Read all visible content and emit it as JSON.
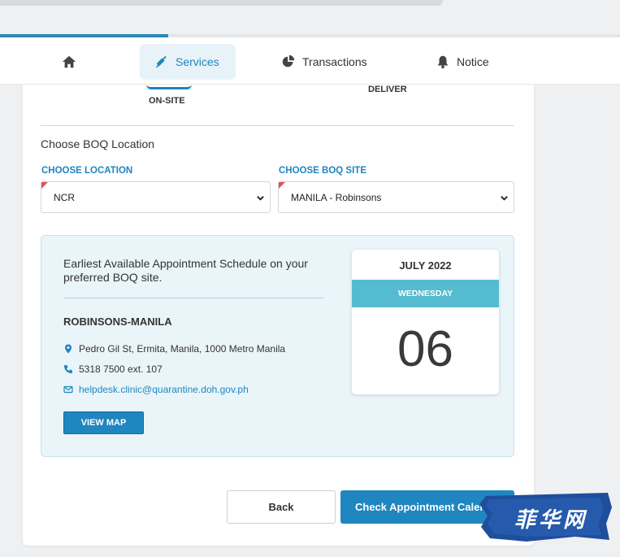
{
  "nav": {
    "items": [
      {
        "label": "",
        "icon": "home-icon"
      },
      {
        "label": "Services",
        "icon": "syringe-icon",
        "active": true
      },
      {
        "label": "Transactions",
        "icon": "pie-chart-icon"
      },
      {
        "label": "Notice",
        "icon": "bell-icon"
      }
    ]
  },
  "steps": {
    "onsite_label": "ON-SITE",
    "deliver_label": "DELIVER"
  },
  "boq": {
    "section_title": "Choose BOQ Location",
    "location_label": "CHOOSE LOCATION",
    "location_value": "NCR",
    "site_label": "CHOOSE BOQ SITE",
    "site_value": "MANILA - Robinsons"
  },
  "schedule": {
    "heading": "Earliest Available Appointment Schedule on your preferred BOQ site.",
    "site_name": "ROBINSONS-MANILA",
    "address": "Pedro Gil St, Ermita, Manila, 1000 Metro Manila",
    "phone": "5318 7500 ext. 107",
    "email": "helpdesk.clinic@quarantine.doh.gov.ph",
    "view_map_label": "VIEW MAP",
    "calendar": {
      "month": "JULY 2022",
      "weekday": "WEDNESDAY",
      "day": "06"
    }
  },
  "actions": {
    "back_label": "Back",
    "check_label": "Check Appointment Calen"
  },
  "watermark": {
    "text": "菲华网"
  },
  "colors": {
    "accent": "#1f86bf",
    "calendar_band": "#55bbd0",
    "info_bg": "#eaf5f9"
  }
}
